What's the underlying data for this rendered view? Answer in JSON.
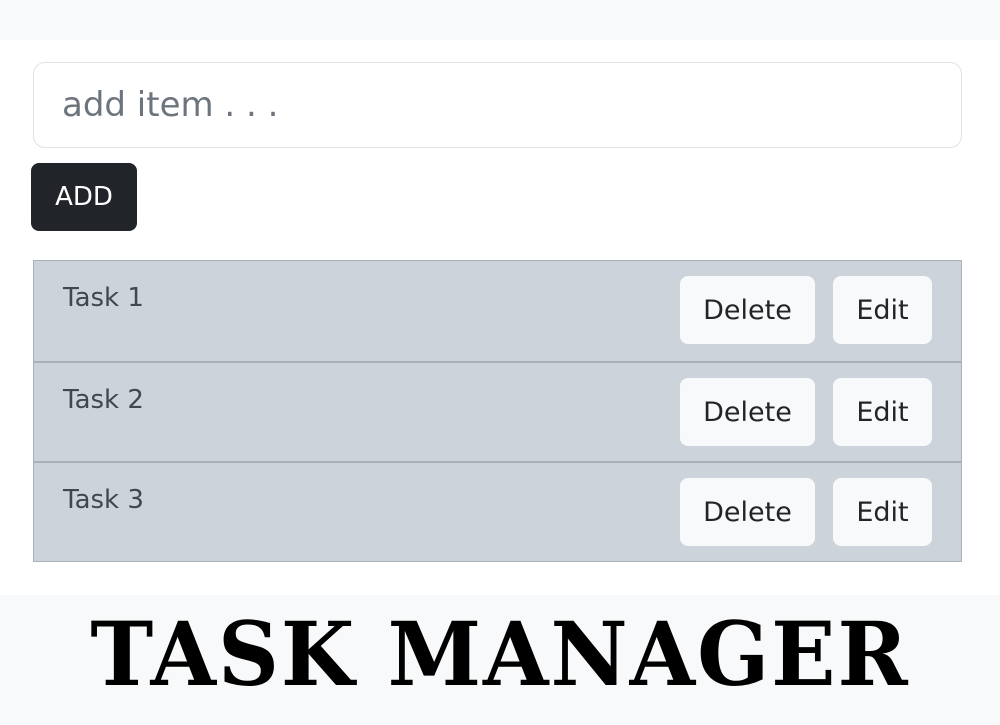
{
  "form": {
    "input_placeholder": "add item . . .",
    "input_value": "",
    "add_label": "ADD"
  },
  "tasks": [
    {
      "label": "Task 1",
      "delete_label": "Delete",
      "edit_label": "Edit"
    },
    {
      "label": "Task 2",
      "delete_label": "Delete",
      "edit_label": "Edit"
    },
    {
      "label": "Task 3",
      "delete_label": "Delete",
      "edit_label": "Edit"
    }
  ],
  "banner": {
    "title": "TASK MANAGER"
  },
  "colors": {
    "add_button_bg": "#212529",
    "list_bg": "#ccd3da",
    "row_button_bg": "#f8f9fa"
  }
}
